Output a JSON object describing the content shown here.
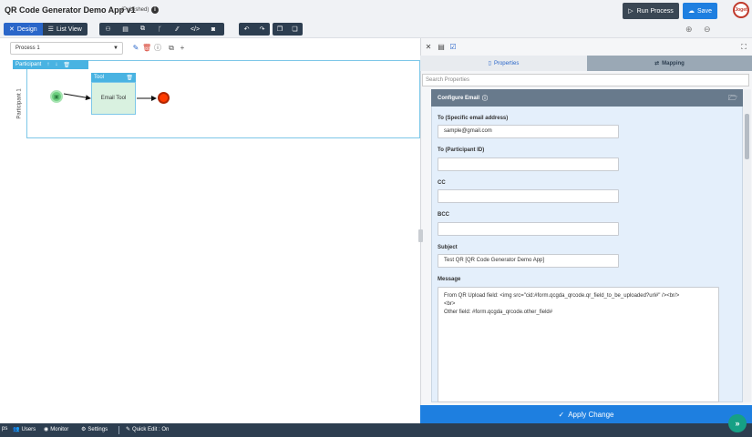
{
  "header": {
    "app_title": "QR Code Generator Demo App v1",
    "app_status": "(Published)",
    "info_icon": "i",
    "run_process_label": "Run Process",
    "save_label": "Save",
    "avatar_text": "Joget"
  },
  "mode_tabs": {
    "design_label": "Design",
    "list_view_label": "List View"
  },
  "toolbar": {
    "tools": [
      "sitemap-icon",
      "form-icon",
      "copy-icon",
      "branch-icon",
      "slash-icon",
      "code-icon",
      "camera-icon"
    ],
    "undo_icon": "undo-icon",
    "redo_icon": "redo-icon",
    "clone_icons": [
      "copy-icon",
      "paste-icon"
    ]
  },
  "canvas": {
    "process_select_value": "Process 1",
    "participant_label": "Participant",
    "lane_name": "Participant 1",
    "tool_tab_label": "Tool",
    "tool_node_label": "Email Tool"
  },
  "panel": {
    "tab_properties": "Properties",
    "tab_mapping": "Mapping",
    "search_placeholder": "Search Properties",
    "section_title": "Configure Email",
    "fields": {
      "to_label": "To (Specific email address)",
      "to_value": "sample@gmail.com",
      "to_pid_label": "To (Participant ID)",
      "to_pid_value": "",
      "cc_label": "CC",
      "cc_value": "",
      "bcc_label": "BCC",
      "bcc_value": "",
      "subject_label": "Subject",
      "subject_value": "Test QR [QR Code Generator Demo App]",
      "message_label": "Message",
      "message_line1": "From QR Upload field: <img src=\"cid:#form.qcgda_qrcode.qr_field_to_be_uploaded?url#\" /><br/>",
      "message_line2": "<br>",
      "message_line3": "Other field: #form.qcgda_qrcode.other_field#"
    },
    "apply_label": "Apply Change"
  },
  "bottom_bar": {
    "apps_label": "ps",
    "users_label": "Users",
    "monitor_label": "Monitor",
    "settings_label": "Settings",
    "quick_edit_label": "Quick Edit : On"
  },
  "colors": {
    "primary": "#1e7fe0",
    "dark": "#2d3e50",
    "lane": "#49b3e2",
    "start": "#6ccf7f",
    "end": "#ff3b00",
    "form_bg": "#e4effb"
  }
}
